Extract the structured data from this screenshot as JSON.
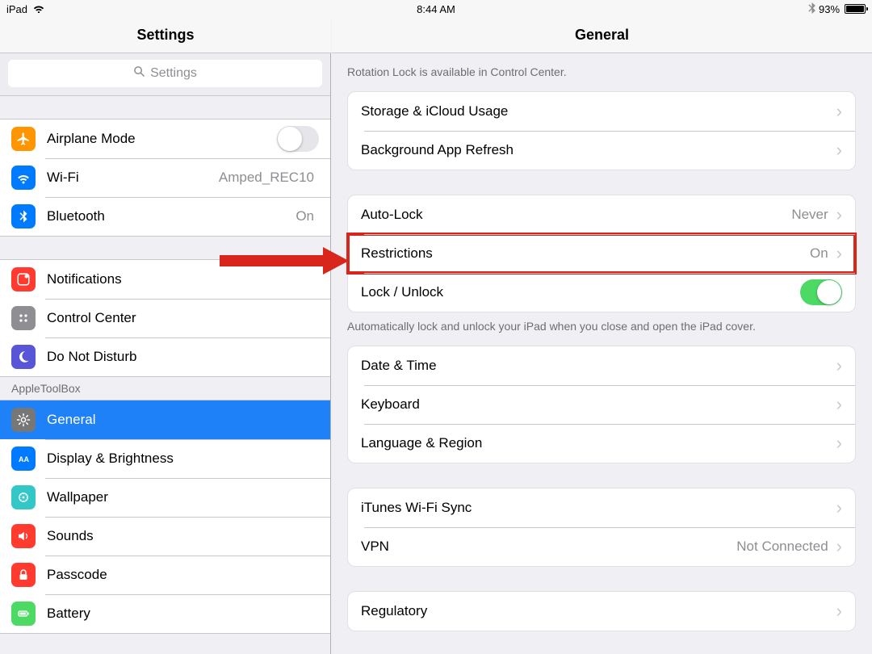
{
  "statusbar": {
    "device": "iPad",
    "time": "8:44 AM",
    "battery_pct": "93%"
  },
  "nav": {
    "left_title": "Settings",
    "right_title": "General"
  },
  "search": {
    "placeholder": "Settings"
  },
  "sidebar": {
    "group1": [
      {
        "label": "Airplane Mode",
        "toggle": false
      },
      {
        "label": "Wi-Fi",
        "value": "Amped_REC10"
      },
      {
        "label": "Bluetooth",
        "value": "On"
      }
    ],
    "group2": [
      {
        "label": "Notifications"
      },
      {
        "label": "Control Center"
      },
      {
        "label": "Do Not Disturb"
      }
    ],
    "group3_header": "AppleToolBox",
    "group3": [
      {
        "label": "General",
        "selected": true
      },
      {
        "label": "Display & Brightness"
      },
      {
        "label": "Wallpaper"
      },
      {
        "label": "Sounds"
      },
      {
        "label": "Passcode"
      },
      {
        "label": "Battery"
      }
    ]
  },
  "detail": {
    "header_note": "Rotation Lock is available in Control Center.",
    "g1": [
      {
        "label": "Storage & iCloud Usage"
      },
      {
        "label": "Background App Refresh"
      }
    ],
    "g2": [
      {
        "label": "Auto-Lock",
        "value": "Never"
      },
      {
        "label": "Restrictions",
        "value": "On",
        "highlight": true
      },
      {
        "label": "Lock / Unlock",
        "toggle": true
      }
    ],
    "g2_footer": "Automatically lock and unlock your iPad when you close and open the iPad cover.",
    "g3": [
      {
        "label": "Date & Time"
      },
      {
        "label": "Keyboard"
      },
      {
        "label": "Language & Region"
      }
    ],
    "g4": [
      {
        "label": "iTunes Wi-Fi Sync"
      },
      {
        "label": "VPN",
        "value": "Not Connected"
      }
    ],
    "g5": [
      {
        "label": "Regulatory"
      }
    ]
  }
}
